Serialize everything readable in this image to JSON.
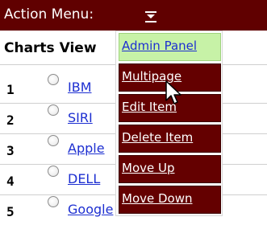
{
  "action_menu": {
    "label": "Action Menu:",
    "dropdown_icon": "dropdown-arrow-icon",
    "items": [
      {
        "label": "Admin Panel",
        "active": true
      },
      {
        "label": "Multipage"
      },
      {
        "label": "Edit Item"
      },
      {
        "label": "Delete Item"
      },
      {
        "label": "Move Up"
      },
      {
        "label": "Move Down"
      }
    ]
  },
  "table": {
    "title": "Charts View",
    "rows": [
      {
        "num": "1",
        "name": "IBM"
      },
      {
        "num": "2",
        "name": "SIRI"
      },
      {
        "num": "3",
        "name": "Apple"
      },
      {
        "num": "4",
        "name": "DELL"
      },
      {
        "num": "5",
        "name": "Google"
      }
    ]
  },
  "colors": {
    "bar": "#600000",
    "menu_item": "#640000",
    "active_item": "#c7f2a7",
    "link": "#1d2fd1"
  }
}
